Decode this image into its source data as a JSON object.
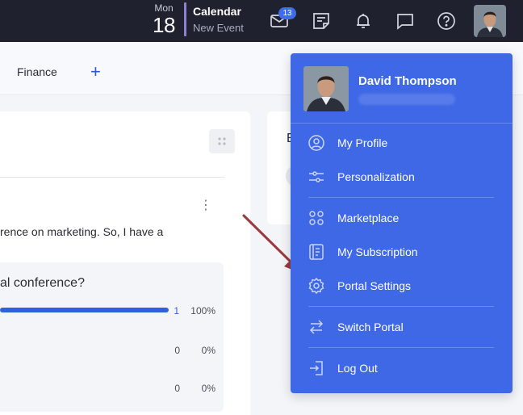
{
  "topbar": {
    "date": {
      "weekday": "Mon",
      "day": "18"
    },
    "calendar": {
      "title": "Calendar",
      "subtitle": "New Event"
    },
    "mail_badge": "13",
    "icons": [
      "mail-icon",
      "notes-icon",
      "bell-icon",
      "chat-icon",
      "help-icon"
    ]
  },
  "tabs": {
    "finance": "Finance",
    "add": "+"
  },
  "post": {
    "text": "rence on marketing. So, I have a",
    "poll_question": "al conference?",
    "options": [
      {
        "count": "1",
        "percent": "100%",
        "fill": 1.0
      },
      {
        "count": "0",
        "percent": "0%",
        "fill": 0
      },
      {
        "count": "0",
        "percent": "0%",
        "fill": 0
      }
    ]
  },
  "card2": {
    "letter": "E"
  },
  "menu": {
    "user_name": "David Thompson",
    "items": [
      {
        "label": "My Profile",
        "icon": "user-circle-icon"
      },
      {
        "label": "Personalization",
        "icon": "sliders-icon"
      },
      {
        "label": "Marketplace",
        "icon": "grid-circles-icon"
      },
      {
        "label": "My Subscription",
        "icon": "subscription-icon"
      },
      {
        "label": "Portal Settings",
        "icon": "gear-icon"
      },
      {
        "label": "Switch Portal",
        "icon": "switch-arrows-icon"
      },
      {
        "label": "Log Out",
        "icon": "logout-icon"
      }
    ]
  },
  "colors": {
    "topbar_bg": "#20212f",
    "menu_bg": "#3f68e6",
    "accent": "#3060dc",
    "arrow": "#9b3a3f"
  }
}
